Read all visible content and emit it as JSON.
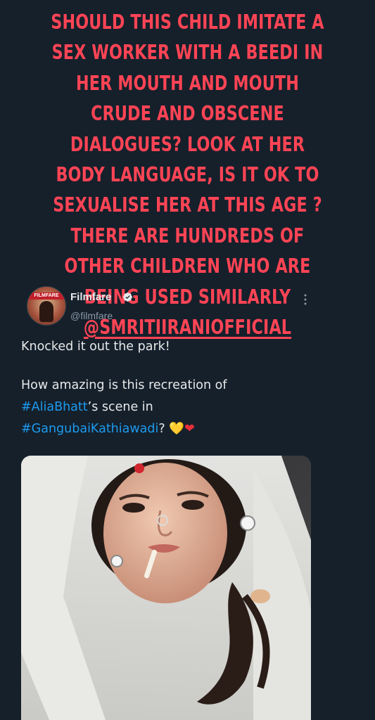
{
  "caption": {
    "text": "SHOULD THIS CHILD IMITATE A SEX WORKER WITH A BEEDI IN HER MOUTH AND MOUTH CRUDE AND OBSCENE DIALOGUES?  LOOK AT HER BODY LANGUAGE, IS IT OK TO SEXUALISE HER AT THIS AGE ? THERE ARE HUNDREDS OF OTHER CHILDREN WHO ARE BEING USED SIMILARLY ",
    "mention": "@SMRITIIRANIOFFICIAL",
    "color": "#ff4455"
  },
  "tweet": {
    "display_name": "Filmfare",
    "handle": "@filmfare",
    "avatar_logo_text": "FILMFARE",
    "verified_icon": "verified-badge-icon",
    "more_icon": "more-options-icon",
    "line1": "Knocked it out the park!",
    "line2_prefix": "How amazing is this recreation of",
    "hashtag1": "#AliaBhatt",
    "line3_suffix": "’s scene in",
    "hashtag2": "#GangubaiKathiawadi",
    "line4_suffix": "?",
    "emoji_yellow_heart": "💛",
    "emoji_red_heart": "❤",
    "hashtag_color": "#1d9bf0"
  },
  "media": {
    "kind": "photo",
    "alt_icon": "child-photo-image"
  }
}
